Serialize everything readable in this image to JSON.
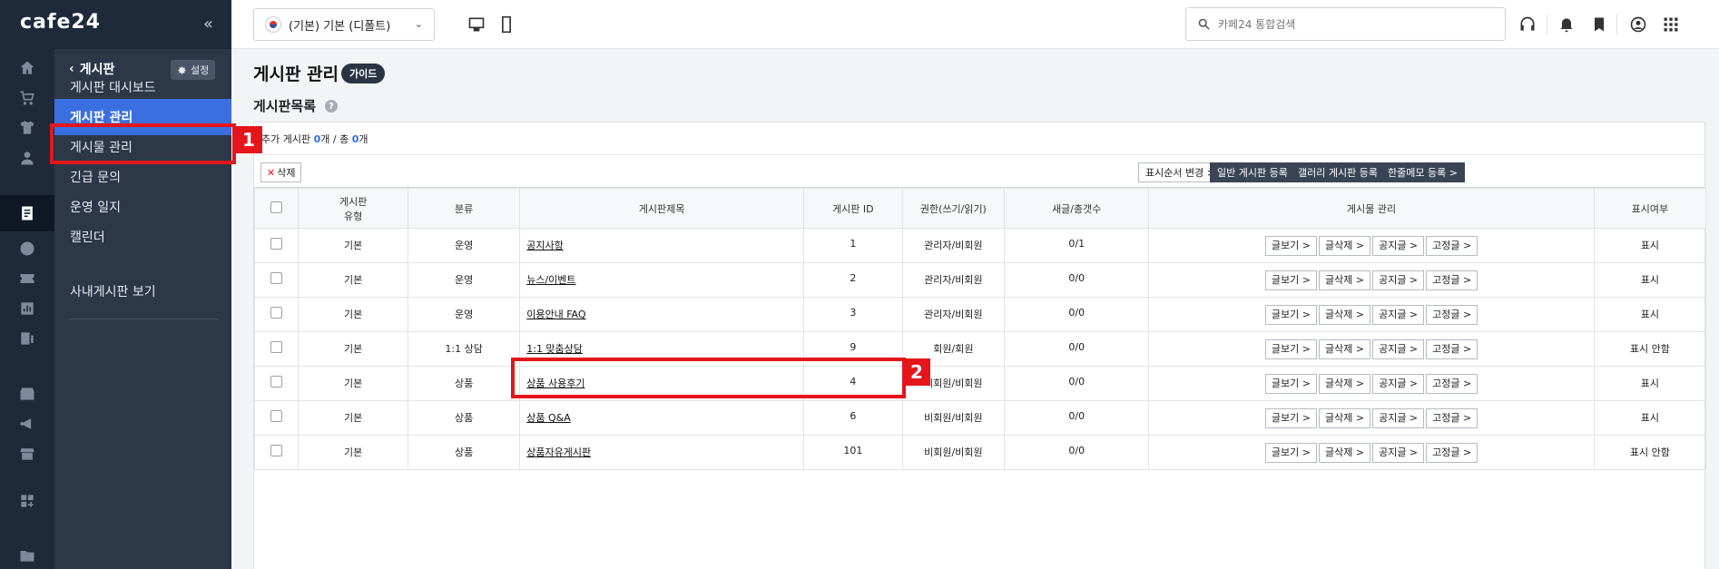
{
  "brand": "cafe24",
  "collapse_icon": "«",
  "sidebar": {
    "header": "게시판",
    "settings_label": "설정",
    "items": [
      {
        "label": "게시판 대시보드"
      },
      {
        "label": "게시판 관리"
      },
      {
        "label": "게시물 관리"
      },
      {
        "label": "긴급 문의"
      },
      {
        "label": "운영 일지"
      },
      {
        "label": "캘린더"
      },
      {
        "label": "사내게시판 보기"
      }
    ]
  },
  "topbar": {
    "shop_selector": "(기본) 기본 (디폴트)",
    "search_placeholder": "카페24 통합검색"
  },
  "page": {
    "title": "게시판 관리",
    "guide_label": "가이드",
    "section_title": "게시판목록",
    "help_label": "?"
  },
  "counts": {
    "prefix": "추가 게시판 ",
    "added": "0",
    "mid": "개 / 총 ",
    "total": "0",
    "suffix": "개"
  },
  "actions": {
    "delete": "삭제",
    "reorder": "표시순서 변경 >",
    "add_general": "일반 게시판 등록 >",
    "add_gallery": "갤러리 게시판 등록 >",
    "add_memo": "한줄메모 등록 >"
  },
  "table": {
    "headers": [
      "게시판\n유형",
      "분류",
      "게시판제목",
      "게시판 ID",
      "권한(쓰기/읽기)",
      "새글/총갯수",
      "게시물 관리",
      "표시여부"
    ],
    "manage_buttons": [
      "글보기 >",
      "글삭제 >",
      "공지글 >",
      "고정글 >"
    ],
    "rows": [
      {
        "type": "기본",
        "cat": "운영",
        "title": "공지사항",
        "id": "1",
        "perm": "관리자/비회원",
        "count": "0/1",
        "display": "표시"
      },
      {
        "type": "기본",
        "cat": "운영",
        "title": "뉴스/이벤트",
        "id": "2",
        "perm": "관리자/비회원",
        "count": "0/0",
        "display": "표시"
      },
      {
        "type": "기본",
        "cat": "운영",
        "title": "이용안내 FAQ",
        "id": "3",
        "perm": "관리자/비회원",
        "count": "0/0",
        "display": "표시"
      },
      {
        "type": "기본",
        "cat": "1:1 상담",
        "title": "1:1 맞춤상담",
        "id": "9",
        "perm": "회원/회원",
        "count": "0/0",
        "display": "표시 안함"
      },
      {
        "type": "기본",
        "cat": "상품",
        "title": "상품 사용후기",
        "id": "4",
        "perm": "비회원/비회원",
        "count": "0/0",
        "display": "표시"
      },
      {
        "type": "기본",
        "cat": "상품",
        "title": "상품 Q&A",
        "id": "6",
        "perm": "비회원/비회원",
        "count": "0/0",
        "display": "표시"
      },
      {
        "type": "기본",
        "cat": "상품",
        "title": "상품자유게시판",
        "id": "101",
        "perm": "비회원/비회원",
        "count": "0/0",
        "display": "표시 안함"
      }
    ]
  },
  "annotations": [
    "1",
    "2"
  ]
}
